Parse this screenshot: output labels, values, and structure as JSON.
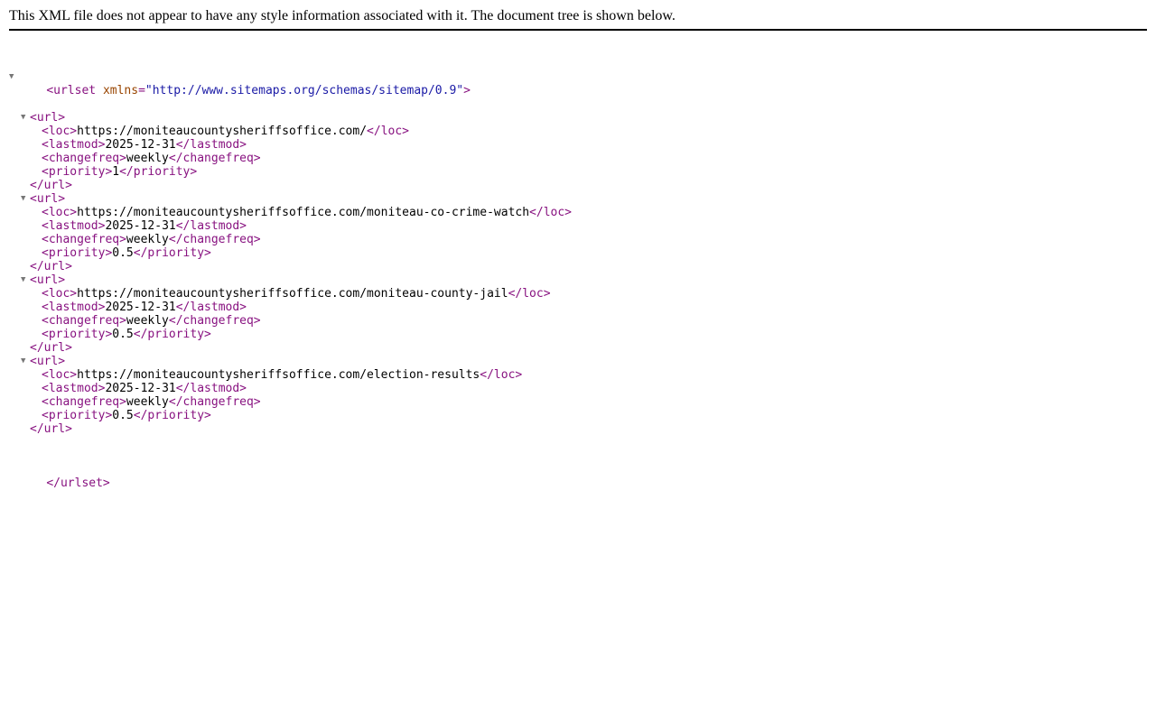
{
  "header": {
    "message": "This XML file does not appear to have any style information associated with it. The document tree is shown below."
  },
  "tree": {
    "root_open": "<urlset",
    "xmlns_name": "xmlns",
    "xmlns_eq": "=",
    "xmlns_value": "\"http://www.sitemaps.org/schemas/sitemap/0.9\"",
    "root_open_end": ">",
    "root_close": "</urlset>",
    "toggle_glyph": "▼",
    "url_open": "<url>",
    "url_close": "</url>",
    "loc_open": "<loc>",
    "loc_close": "</loc>",
    "lastmod_open": "<lastmod>",
    "lastmod_close": "</lastmod>",
    "changefreq_open": "<changefreq>",
    "changefreq_close": "</changefreq>",
    "priority_open": "<priority>",
    "priority_close": "</priority>",
    "urls": [
      {
        "loc": "https://moniteaucountysheriffsoffice.com/",
        "lastmod": "2025-12-31",
        "changefreq": "weekly",
        "priority": "1"
      },
      {
        "loc": "https://moniteaucountysheriffsoffice.com/moniteau-co-crime-watch",
        "lastmod": "2025-12-31",
        "changefreq": "weekly",
        "priority": "0.5"
      },
      {
        "loc": "https://moniteaucountysheriffsoffice.com/moniteau-county-jail",
        "lastmod": "2025-12-31",
        "changefreq": "weekly",
        "priority": "0.5"
      },
      {
        "loc": "https://moniteaucountysheriffsoffice.com/election-results",
        "lastmod": "2025-12-31",
        "changefreq": "weekly",
        "priority": "0.5"
      }
    ]
  },
  "colors": {
    "tag": "#881280",
    "attribute_name": "#994500",
    "attribute_value": "#1a1aa6",
    "toggle": "#777777"
  }
}
